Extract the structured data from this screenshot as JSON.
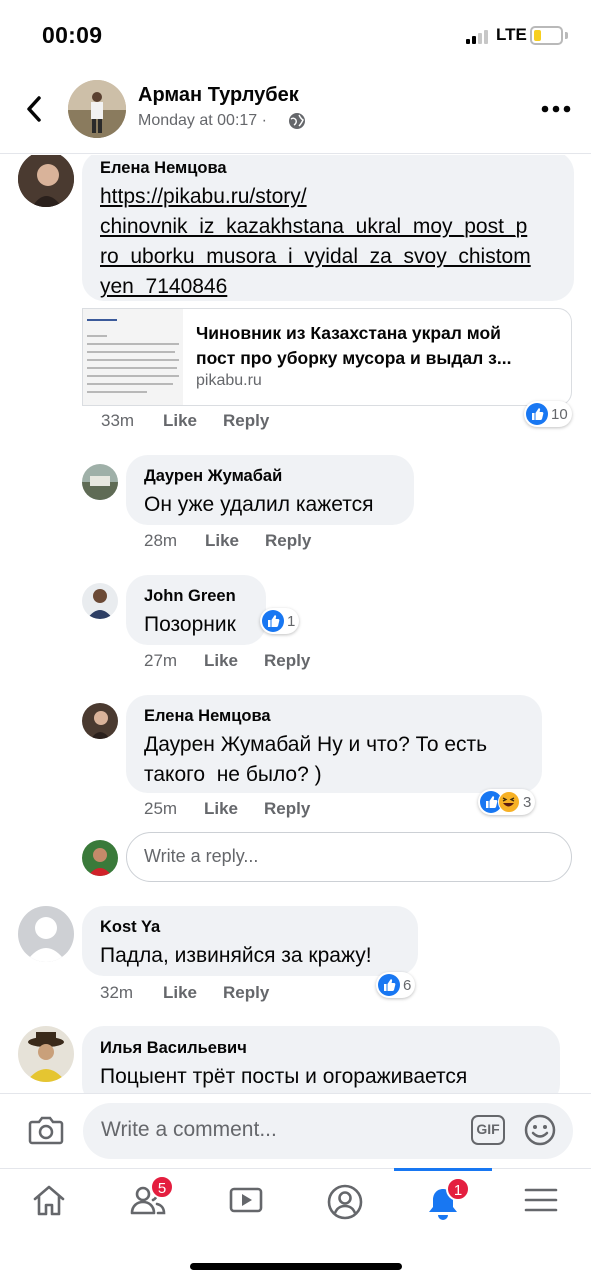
{
  "status_bar": {
    "time": "00:09",
    "network": "LTE",
    "battery_color": "#f7cf1e"
  },
  "header": {
    "name": "Арман Турлубек",
    "subtitle": "Monday at 00:17 ·",
    "back_icon": "chevron-left-icon",
    "privacy_icon": "globe-icon",
    "more_icon": "more-horizontal-icon"
  },
  "comments": [
    {
      "author": "Елена Немцова",
      "link_lines": [
        "https://pikabu.ru/story/",
        "chinovnik_iz_kazakhstana_ukral_moy_post_p",
        "ro_uborku_musora_i_vyidal_za_svoy_chistom",
        "yen_7140846"
      ],
      "preview": {
        "title_line1": "Чиновник из Казахстана украл мой",
        "title_line2": "пост про уборку мусора и выдал з...",
        "domain": "pikabu.ru"
      },
      "time": "33m",
      "like": "Like",
      "reply": "Reply",
      "reactions": "10"
    },
    {
      "author": "Даурен Жумабай",
      "text": "Он уже удалил кажется",
      "time": "28m",
      "like": "Like",
      "reply": "Reply"
    },
    {
      "author": "John Green",
      "text": "Позорник",
      "time": "27m",
      "like": "Like",
      "reply": "Reply",
      "reactions": "1"
    },
    {
      "author": "Елена Немцова",
      "text_line1": "Даурен Жумабай Ну и что? То есть",
      "text_line2": "такого  не было? )",
      "time": "25m",
      "like": "Like",
      "reply": "Reply",
      "reactions": "3"
    },
    {
      "author": "Kost Ya",
      "text": "Падла, извиняйся за кражу!",
      "time": "32m",
      "like": "Like",
      "reply": "Reply",
      "reactions": "6"
    },
    {
      "author": "Илья Васильевич",
      "text": "Поцыент трёт посты и огораживается"
    }
  ],
  "reply_box": {
    "placeholder": "Write a reply..."
  },
  "composer": {
    "placeholder": "Write a comment...",
    "gif_label": "GIF"
  },
  "tabbar": {
    "friends_badge": "5",
    "notifications_badge": "1",
    "accent": "#1877f2",
    "badge_color": "#e41e3f"
  }
}
